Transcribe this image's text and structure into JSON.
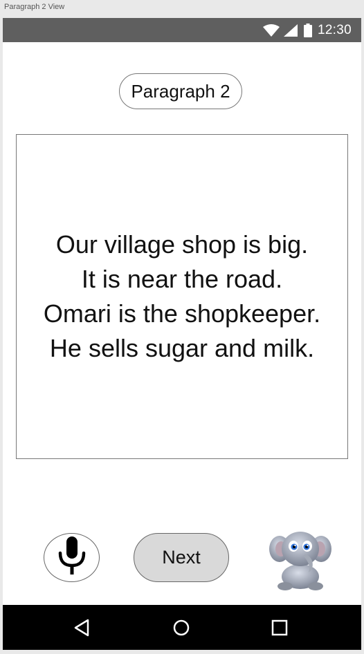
{
  "window": {
    "title": "Paragraph 2 View"
  },
  "status_bar": {
    "time": "12:30",
    "icons": [
      "wifi-icon",
      "signal-icon",
      "battery-icon"
    ]
  },
  "header": {
    "chip_label": "Paragraph 2"
  },
  "paragraph": {
    "lines": [
      "Our village shop is big.",
      "It is near the road.",
      "Omari is the shopkeeper.",
      "He sells sugar and milk."
    ]
  },
  "controls": {
    "mic_icon": "microphone-icon",
    "next_label": "Next",
    "mascot": "elephant-mascot"
  },
  "nav_bar": {
    "icons": [
      "back-icon",
      "home-icon",
      "recents-icon"
    ]
  },
  "colors": {
    "status_bar": "#5f5f5f",
    "nav_bar": "#000000",
    "next_button_fill": "#d9d9d9",
    "border": "#777777"
  }
}
